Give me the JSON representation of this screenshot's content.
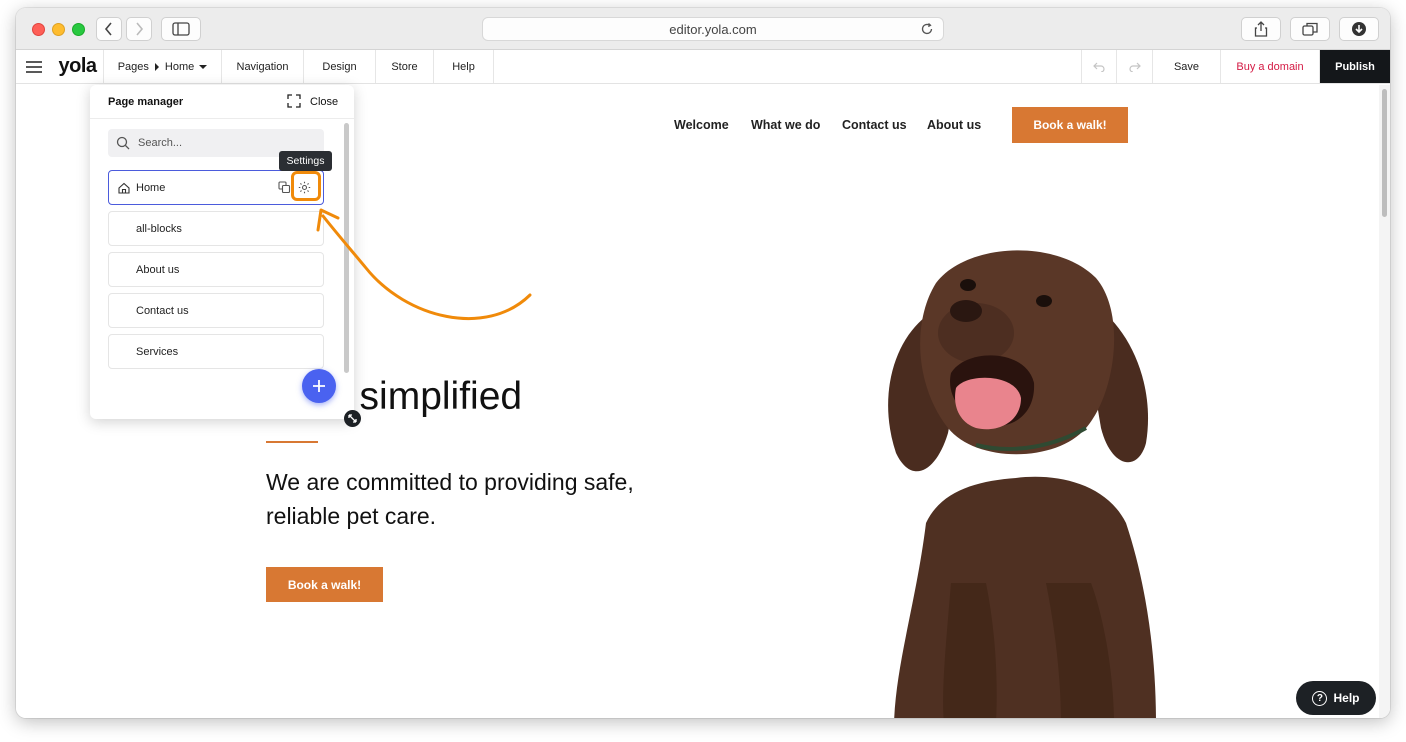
{
  "browser": {
    "url": "editor.yola.com"
  },
  "toolbar": {
    "logo": "yola",
    "pages_label": "Pages",
    "current_page": "Home",
    "navigation": "Navigation",
    "design": "Design",
    "store": "Store",
    "help": "Help",
    "save": "Save",
    "buy_domain": "Buy a domain",
    "publish": "Publish"
  },
  "site": {
    "nav": [
      "Welcome",
      "What we do",
      "Contact us",
      "About us"
    ],
    "cta": "Book a walk!",
    "hero_title": "care, simplified",
    "hero_subtitle": "We are committed to providing safe, reliable pet care.",
    "hero_button": "Book a walk!"
  },
  "page_manager": {
    "title": "Page manager",
    "close": "Close",
    "search_placeholder": "Search...",
    "tooltip": "Settings",
    "pages": [
      "Home",
      "all-blocks",
      "About us",
      "Contact us",
      "Services"
    ]
  },
  "help_button": "Help",
  "colors": {
    "accent": "#d87833",
    "highlight": "#f08a0a",
    "fab": "#4a62f0",
    "publish_bg": "#14171a",
    "buy_domain": "#d41a44"
  }
}
